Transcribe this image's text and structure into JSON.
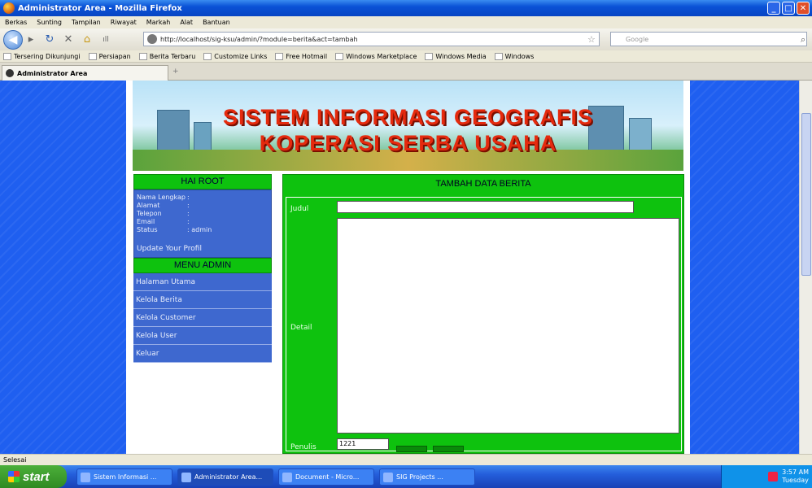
{
  "window": {
    "title": "Administrator Area - Mozilla Firefox"
  },
  "menubar": [
    "Berkas",
    "Sunting",
    "Tampilan",
    "Riwayat",
    "Markah",
    "Alat",
    "Bantuan"
  ],
  "nav": {
    "url": "http://localhost/sig-ksu/admin/?module=berita&act=tambah",
    "search_placeholder": "Google"
  },
  "bookmarks": [
    "Tersering Dikunjungi",
    "Persiapan",
    "Berita Terbaru",
    "Customize Links",
    "Free Hotmail",
    "Windows Marketplace",
    "Windows Media",
    "Windows"
  ],
  "tab": {
    "label": "Administrator Area",
    "new_tab": "+"
  },
  "banner": {
    "line1": "SISTEM INFORMASI GEOGRAFIS",
    "line2": "KOPERASI SERBA USAHA"
  },
  "left_panel": {
    "greeting": "HAI ROOT",
    "profile": [
      {
        "k": "Nama Lengkap",
        "v": ":"
      },
      {
        "k": "Alamat",
        "v": ":"
      },
      {
        "k": "Telepon",
        "v": ":"
      },
      {
        "k": "Email",
        "v": ":"
      },
      {
        "k": "Status",
        "v": ": admin"
      }
    ],
    "update_link": "Update Your Profil",
    "menu_title": "MENU ADMIN",
    "menu": [
      "Halaman Utama",
      "Kelola Berita",
      "Kelola Customer",
      "Kelola User",
      "Keluar"
    ]
  },
  "form": {
    "title": "TAMBAH DATA BERITA",
    "judul_label": "Judul",
    "judul_value": "",
    "detail_label": "Detail",
    "detail_value": "",
    "penulis_label": "Penulis",
    "penulis_value": "1221"
  },
  "status": "Selesai",
  "taskbar": {
    "start": "start",
    "items": [
      "Sistem Informasi ...",
      "Administrator Area...",
      "Document - Micro...",
      "SIG Projects ..."
    ],
    "clock": "3:57 AM",
    "day": "Tuesday"
  }
}
